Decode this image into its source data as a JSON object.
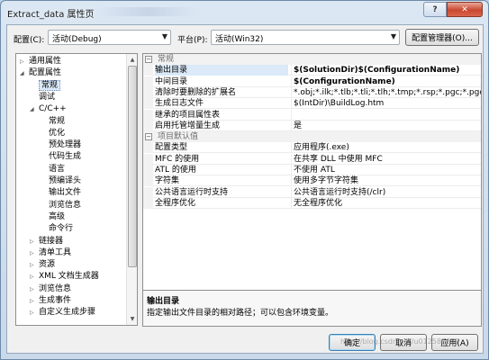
{
  "window": {
    "title": "Extract_data 属性页"
  },
  "titlebar": {
    "help_glyph": "?",
    "close_glyph": "✕"
  },
  "toolbar": {
    "config_label": "配置(C):",
    "config_value": "活动(Debug)",
    "platform_label": "平台(P):",
    "platform_value": "活动(Win32)",
    "config_manager_button": "配置管理器(O)..."
  },
  "tree": {
    "items": [
      {
        "label": "通用属性",
        "level": 0,
        "toggle": "▷"
      },
      {
        "label": "配置属性",
        "level": 0,
        "toggle": "◢"
      },
      {
        "label": "常规",
        "level": 1,
        "toggle": "",
        "selected": true
      },
      {
        "label": "调试",
        "level": 1,
        "toggle": ""
      },
      {
        "label": "C/C++",
        "level": 1,
        "toggle": "◢"
      },
      {
        "label": "常规",
        "level": 2,
        "toggle": ""
      },
      {
        "label": "优化",
        "level": 2,
        "toggle": ""
      },
      {
        "label": "预处理器",
        "level": 2,
        "toggle": ""
      },
      {
        "label": "代码生成",
        "level": 2,
        "toggle": ""
      },
      {
        "label": "语言",
        "level": 2,
        "toggle": ""
      },
      {
        "label": "预编译头",
        "level": 2,
        "toggle": ""
      },
      {
        "label": "输出文件",
        "level": 2,
        "toggle": ""
      },
      {
        "label": "浏览信息",
        "level": 2,
        "toggle": ""
      },
      {
        "label": "高级",
        "level": 2,
        "toggle": ""
      },
      {
        "label": "命令行",
        "level": 2,
        "toggle": ""
      },
      {
        "label": "链接器",
        "level": 1,
        "toggle": "▷"
      },
      {
        "label": "清单工具",
        "level": 1,
        "toggle": "▷"
      },
      {
        "label": "资源",
        "level": 1,
        "toggle": "▷"
      },
      {
        "label": "XML 文档生成器",
        "level": 1,
        "toggle": "▷"
      },
      {
        "label": "浏览信息",
        "level": 1,
        "toggle": "▷"
      },
      {
        "label": "生成事件",
        "level": 1,
        "toggle": "▷"
      },
      {
        "label": "自定义生成步骤",
        "level": 1,
        "toggle": "▷"
      }
    ]
  },
  "grid": {
    "categories": [
      {
        "title": "常规",
        "toggle": "⊟",
        "rows": [
          {
            "name": "输出目录",
            "value": "$(SolutionDir)$(ConfigurationName)",
            "bold": true,
            "selected": true
          },
          {
            "name": "中间目录",
            "value": "$(ConfigurationName)",
            "bold": true
          },
          {
            "name": "清除时要删除的扩展名",
            "value": "*.obj;*.ilk;*.tlb;*.tli;*.tlh;*.tmp;*.rsp;*.pgc;*.pgd;*.meta;$(Ta"
          },
          {
            "name": "生成日志文件",
            "value": "$(IntDir)\\BuildLog.htm"
          },
          {
            "name": "继承的项目属性表",
            "value": ""
          },
          {
            "name": "启用托管增量生成",
            "value": "是"
          }
        ]
      },
      {
        "title": "项目默认值",
        "toggle": "⊟",
        "rows": [
          {
            "name": "配置类型",
            "value": "应用程序(.exe)"
          },
          {
            "name": "MFC 的使用",
            "value": "在共享 DLL 中使用 MFC"
          },
          {
            "name": "ATL 的使用",
            "value": "不使用 ATL"
          },
          {
            "name": "字符集",
            "value": "使用多字节字符集"
          },
          {
            "name": "公共语言运行时支持",
            "value": "公共语言运行时支持(/clr)"
          },
          {
            "name": "全程序优化",
            "value": "无全程序优化"
          }
        ]
      }
    ]
  },
  "description": {
    "title": "输出目录",
    "text": "指定输出文件目录的相对路径；可以包含环境变量。"
  },
  "footer": {
    "ok_button": "确定",
    "cancel_button": "取消",
    "apply_button": "应用(A)"
  },
  "watermark": "http://blog.csdn.net/u012587637"
}
